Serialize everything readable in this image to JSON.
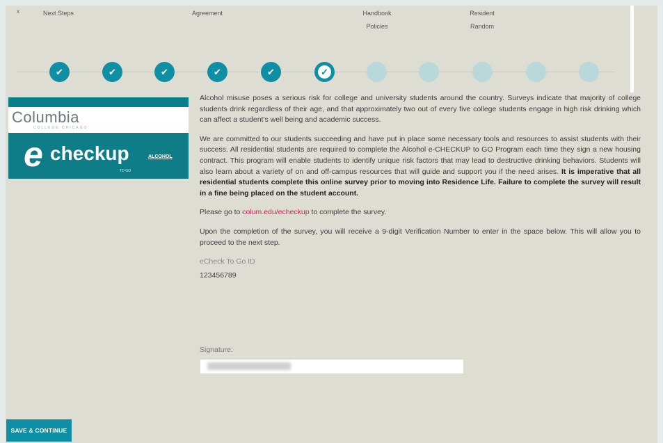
{
  "steps": {
    "labels": [
      "Next Steps",
      "Agreement",
      "Handbook\nPolicies",
      "Resident\nRandom"
    ],
    "cut_labels": [
      "",
      "",
      "",
      "",
      "",
      "",
      "",
      "",
      ""
    ],
    "marker": "x"
  },
  "progress": {
    "done": 5,
    "current": 6,
    "total": 11
  },
  "logo": {
    "college": "Columbia",
    "subtitle": "COLLEGE CHICAGO",
    "brand": "echeckup",
    "e_letter": "e",
    "check_text": "checkup",
    "alcohol": "ALCOHOL",
    "togo": "TO GO"
  },
  "content": {
    "p1": "Alcohol misuse poses a serious risk for college and university students around the country. Surveys indicate that majority of college students drink regardless of their age, and that approximately two out of every five college students engage in high risk drinking which can affect a student's well being and academic success.",
    "p2_plain": "We are committed to our students succeeding and have put in place some necessary tools and resources to assist students with their success. All residential students are required to complete the Alcohol e-CHECKUP to GO Program each time they sign a new housing contract. This program will enable students to identify unique risk factors that may lead to destructive drinking behaviors. Students will also learn about a variety of on and off-campus resources that will guide and support you if the need arises.",
    "p2_bold": "It is imperative that all residential students complete this online survey prior to moving into Residence Life. Failure to complete the survey will result in a fine being placed on the student account.",
    "p3_before": "Please go to ",
    "p3_link": "colum.edu/echeckup",
    "p3_after": " to complete the survey.",
    "p4": "Upon the completion of the survey, you will receive a 9-digit Verification Number to enter in the space below. This will allow you to proceed to the next step.",
    "id_label": "eCheck To Go ID",
    "id_value": "123456789",
    "signature_label": "Signature:"
  },
  "buttons": {
    "save": "SAVE & CONTINUE"
  },
  "colors": {
    "accent": "#0e8fa3",
    "pending": "#b9d8da",
    "background": "#deddd3",
    "link": "#cc2255"
  }
}
